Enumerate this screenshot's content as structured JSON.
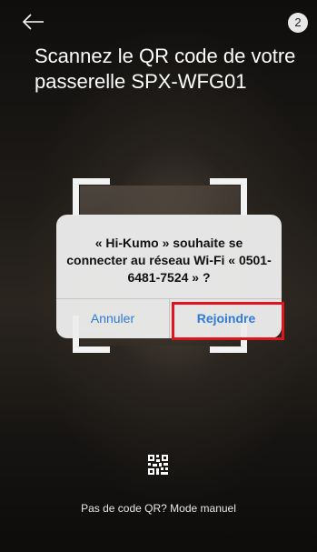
{
  "header": {
    "back_icon": "arrow-left-icon",
    "step_number": "2",
    "title": "Scannez le QR code de votre passerelle SPX-WFG01"
  },
  "dialog": {
    "message": "« Hi-Kumo » souhaite se connecter au réseau Wi-Fi « 0501-6481-7524 » ?",
    "cancel_label": "Annuler",
    "join_label": "Rejoindre",
    "button_color": "#2f7bd6"
  },
  "highlight_color": "#e0141c",
  "footer": {
    "qr_icon": "qr-code-icon",
    "manual_link": "Pas de code QR? Mode manuel"
  }
}
